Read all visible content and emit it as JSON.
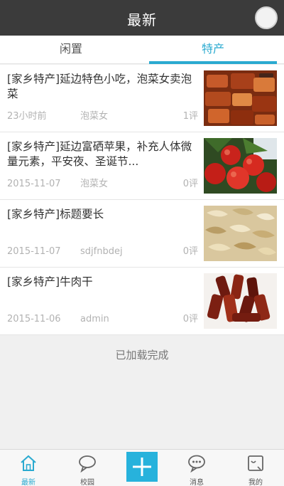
{
  "header": {
    "title": "最新"
  },
  "tabs": [
    {
      "label": "闲置"
    },
    {
      "label": "特产"
    }
  ],
  "items": [
    {
      "title": "[家乡特产]延边特色小吃，泡菜女卖泡菜",
      "time": "23小时前",
      "author": "泡菜女",
      "comments": "1评",
      "thumb": "kimchi-image"
    },
    {
      "title": "[家乡特产]延边富硒苹果，补充人体微量元素，平安夜、圣诞节...",
      "time": "2015-11-07",
      "author": "泡菜女",
      "comments": "0评",
      "thumb": "apples-image"
    },
    {
      "title": "[家乡特产]标题要长",
      "time": "2015-11-07",
      "author": "sdjfnbdej",
      "comments": "0评",
      "thumb": "dried-snack-image"
    },
    {
      "title": "[家乡特产]牛肉干",
      "time": "2015-11-06",
      "author": "admin",
      "comments": "0评",
      "thumb": "beef-jerky-image"
    }
  ],
  "status": {
    "loaded": "已加载完成"
  },
  "nav": [
    {
      "label": "最新",
      "icon": "home-icon"
    },
    {
      "label": "校园",
      "icon": "chat-bubble-icon"
    },
    {
      "label": "",
      "icon": "plus-icon"
    },
    {
      "label": "消息",
      "icon": "message-icon"
    },
    {
      "label": "我的",
      "icon": "profile-icon"
    }
  ],
  "colors": {
    "accent": "#2aaad0",
    "topbar": "#3b3b3b",
    "add_button": "#27b2dc"
  }
}
